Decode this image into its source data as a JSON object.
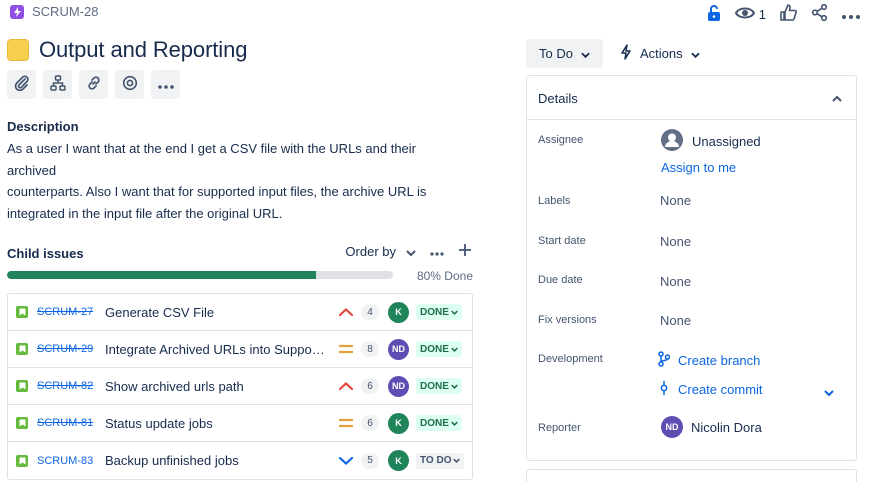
{
  "header": {
    "issue_key": "SCRUM-28",
    "watch_count": "1"
  },
  "title": "Output and Reporting",
  "description": {
    "heading": "Description",
    "lines": [
      "As a user I want that at the end I get a CSV file with the URLs and their archived",
      "counterparts. Also I want that for supported input files, the archive URL is",
      "integrated in the input file after the original URL."
    ]
  },
  "child_issues": {
    "title": "Child issues",
    "order_by_label": "Order by",
    "progress_label": "80% Done",
    "progress_fraction": 0.8,
    "items": [
      {
        "key": "SCRUM-27",
        "summary": "Generate CSV File",
        "priority": "high",
        "points": "4",
        "assignee_initials": "K",
        "assignee_color": "#1f845a",
        "status": "DONE",
        "done": true
      },
      {
        "key": "SCRUM-29",
        "summary": "Integrate Archived URLs into Support...",
        "priority": "medium",
        "points": "8",
        "assignee_initials": "ND",
        "assignee_color": "#5e4db2",
        "status": "DONE",
        "done": true
      },
      {
        "key": "SCRUM-82",
        "summary": "Show archived urls path",
        "priority": "high",
        "points": "6",
        "assignee_initials": "ND",
        "assignee_color": "#5e4db2",
        "status": "DONE",
        "done": true
      },
      {
        "key": "SCRUM-81",
        "summary": "Status update jobs",
        "priority": "medium",
        "points": "6",
        "assignee_initials": "K",
        "assignee_color": "#1f845a",
        "status": "DONE",
        "done": true
      },
      {
        "key": "SCRUM-83",
        "summary": "Backup unfinished jobs",
        "priority": "low",
        "points": "5",
        "assignee_initials": "K",
        "assignee_color": "#1f845a",
        "status": "TO DO",
        "done": false
      }
    ]
  },
  "status_button": {
    "label": "To Do"
  },
  "actions_button": {
    "label": "Actions"
  },
  "details": {
    "title": "Details",
    "assignee": {
      "label": "Assignee",
      "value": "Unassigned",
      "assign_link": "Assign to me"
    },
    "labels": {
      "label": "Labels",
      "value": "None"
    },
    "start_date": {
      "label": "Start date",
      "value": "None"
    },
    "due_date": {
      "label": "Due date",
      "value": "None"
    },
    "fix_versions": {
      "label": "Fix versions",
      "value": "None"
    },
    "development": {
      "label": "Development",
      "create_branch": "Create branch",
      "create_commit": "Create commit"
    },
    "reporter": {
      "label": "Reporter",
      "name": "Nicolin Dora",
      "initials": "ND",
      "color": "#5e4db2"
    }
  },
  "colors": {
    "accent": "#0c66e4",
    "done_green": "#1f845a",
    "epic_purple": "#904ee2",
    "story_green": "#63ba3c"
  }
}
